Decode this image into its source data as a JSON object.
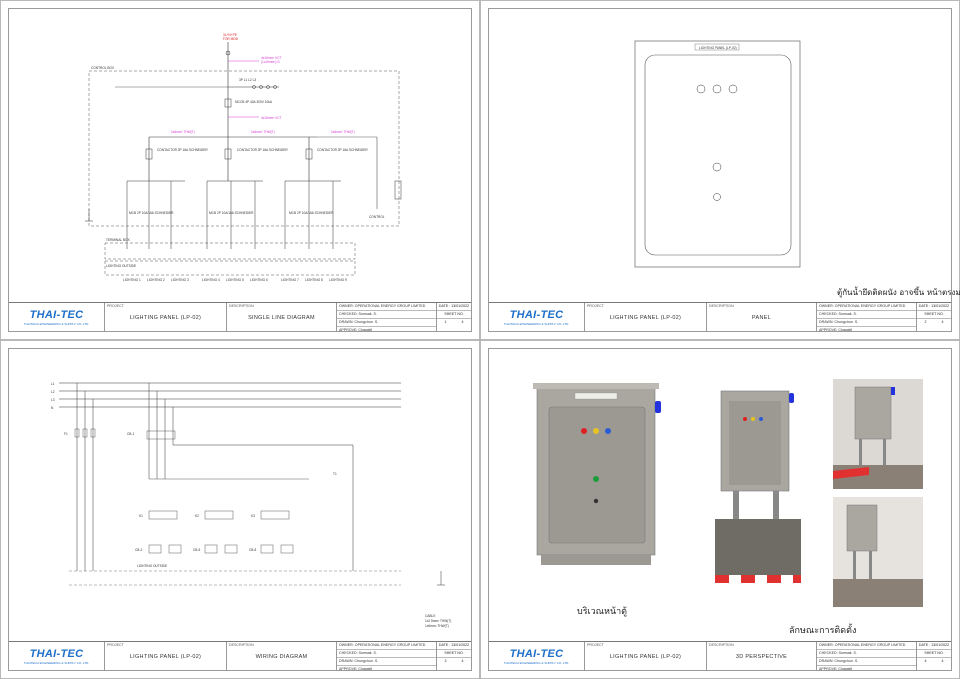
{
  "common": {
    "logo": "THAI-TEC",
    "logo_sub": "THAITECH ENGINEERING & SUPPLY CO.,LTD.",
    "project_label": "PROJECT",
    "description_label": "DESCRIPTION",
    "project_name": "LIGHTING PANEL (LP-02)",
    "owner": "OWNER: OPERATIONAL ENERGY GROUP LIMITED",
    "checked": "CHECKED: Somsak .S.",
    "drawn": "DRAWN: Chungchon .S.",
    "approve": "APPROVE: Chawalit",
    "date": "DATE : 13/01/2022",
    "sheet_label": "SHEET NO."
  },
  "sheets": [
    {
      "description": "SINGLE LINE DIAGRAM",
      "sheet": "1",
      "of": "4"
    },
    {
      "description": "PANEL",
      "sheet": "2",
      "of": "4"
    },
    {
      "description": "WIRING DIAGRAM",
      "sheet": "3",
      "of": "4"
    },
    {
      "description": "3D PERSPECTIVE",
      "sheet": "4",
      "of": "4"
    }
  ],
  "sld": {
    "source": "3L+N+PE",
    "source2": "FOR MDB",
    "cable_in": "4x16mm² VCT",
    "cable_in2": "(1x16mm²) G",
    "busbar": "3P  L1  L2  L3",
    "mcb_main": "MCCB 4P 40A 300V 10kA",
    "contactors": [
      "CONTACTOR 3P 16A SCHNEIDER",
      "CONTACTOR 3P 16A SCHNEIDER",
      "CONTACTOR 3P 16A SCHNEIDER"
    ],
    "feeder_cable": "2x6mm² THW(T)",
    "mcb_label": "MCB 2P 10A/16A SCHNEIDER",
    "control": "CONTROL",
    "control_box": "CONTROL BOX",
    "terminal_box": "TERMINAL BOX",
    "lighting_outside": "LIGHTING OUTSIDE",
    "loads": [
      "LIGHTING 1",
      "LIGHTING 2",
      "LIGHTING 3",
      "LIGHTING 4",
      "LIGHTING 5",
      "LIGHTING 6",
      "LIGHTING 7",
      "LIGHTING 8",
      "LIGHTING 9"
    ]
  },
  "panel": {
    "nameplate": "LIGHTING PANEL (LP-02)",
    "thai_note": "ตู้กันน้ำยึดติดผนัง อาจขึ้น หน้าตรงมา"
  },
  "wiring": {
    "phases": [
      "L1",
      "L2",
      "L3",
      "N"
    ],
    "labels": [
      "F1",
      "CB-1",
      "K1",
      "K2",
      "K3",
      "T1"
    ],
    "cb_labels": [
      "CB-2",
      "CB-3",
      "CB-4",
      "CB-5",
      "CB-6",
      "CB-7",
      "CB-8",
      "CB-9",
      "CB-10"
    ],
    "outside": "LIGHTING OUTSIDE",
    "cable_note": "CABLE",
    "cable_1": "1x2.5mm² THW(T)",
    "cable_2": "1x6mm² THW(T)"
  },
  "perspective": {
    "front_caption": "บริเวณหน้าตู้",
    "install_caption": "ลักษณะการติดตั้ง"
  },
  "colors": {
    "logo": "#1e6fc9",
    "cabinet": "#a9a6a0",
    "pilot_red": "#e02020",
    "pilot_blue": "#2a5bd7",
    "pilot_green": "#1c9c3a",
    "alarm_blue": "#2233dd",
    "cable_magenta": "#d43bd4"
  }
}
